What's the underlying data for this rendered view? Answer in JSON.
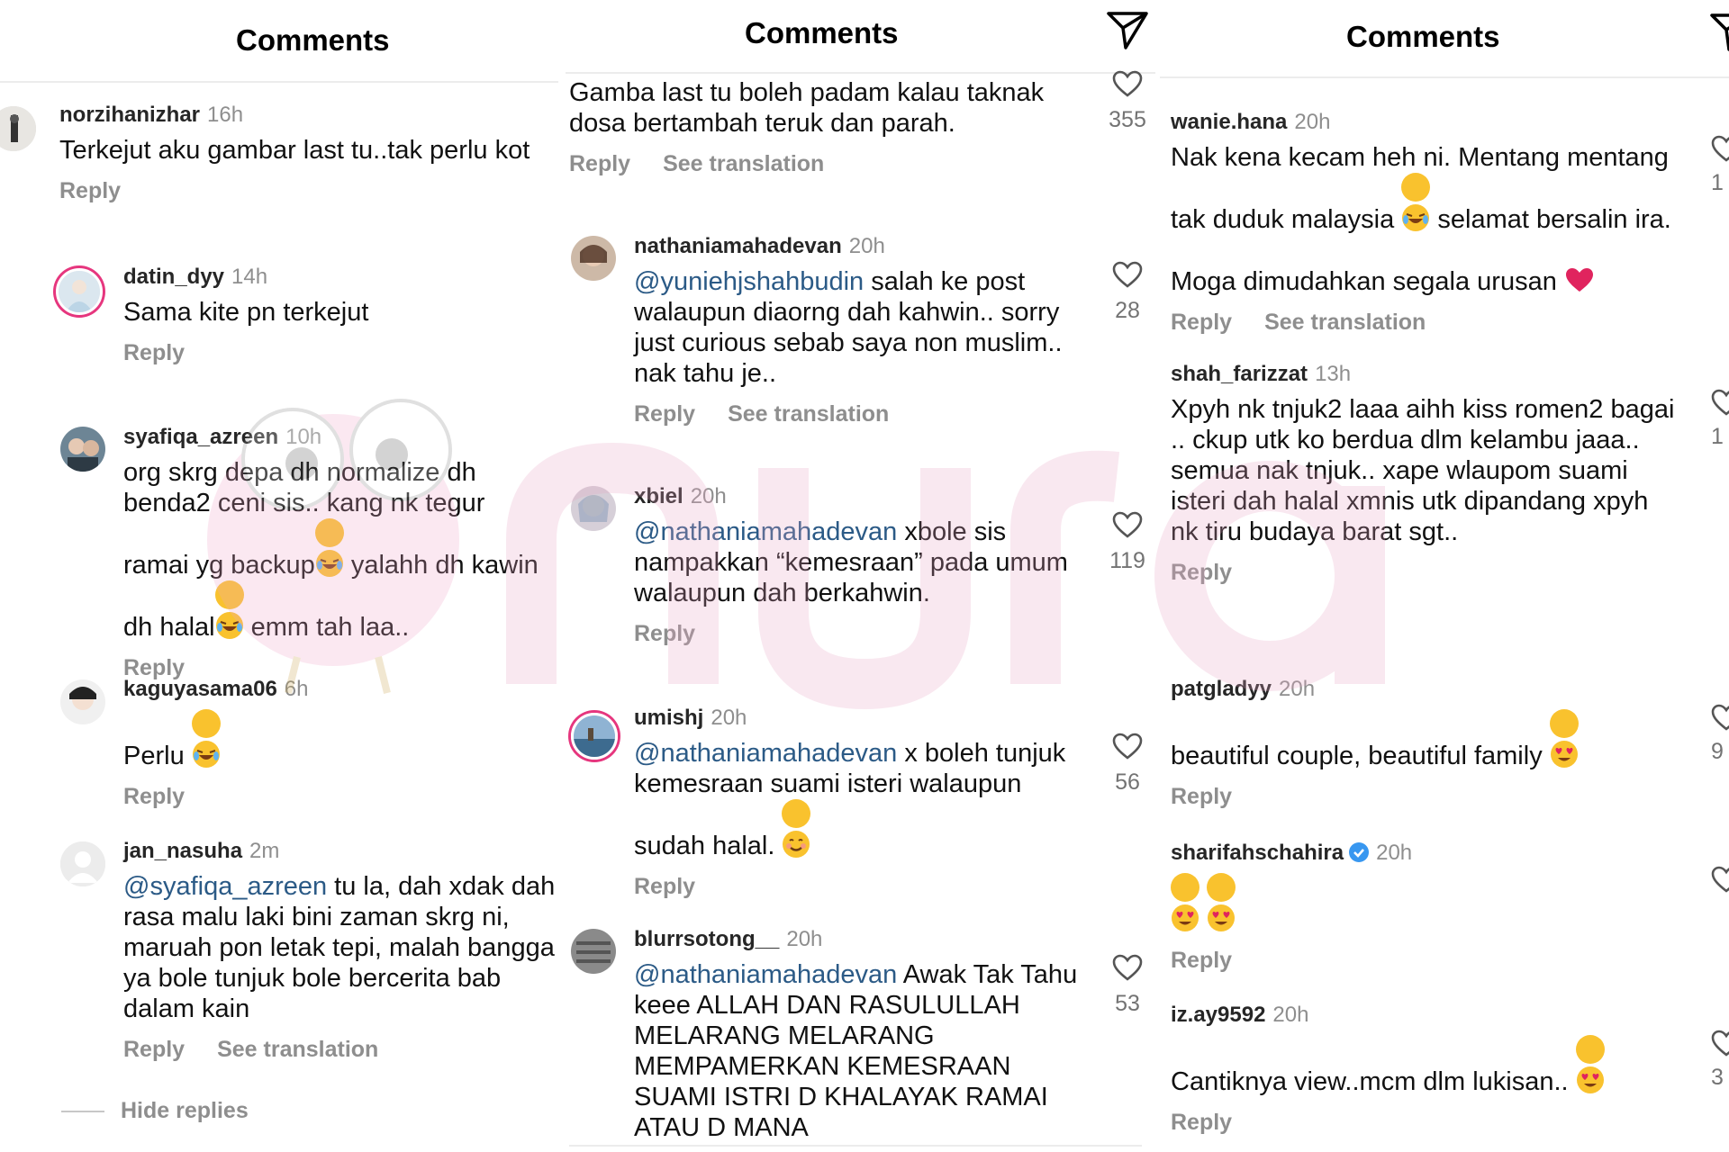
{
  "panel1": {
    "title": "Comments",
    "comments": [
      {
        "user": "norzihanizhar",
        "time": "16h",
        "text": "Terkejut aku gambar last tu..tak perlu kot",
        "reply": "Reply"
      },
      {
        "user": "datin_dyy",
        "time": "14h",
        "text": "Sama kite pn terkejut",
        "reply": "Reply"
      },
      {
        "user": "syafiqa_azreen",
        "time": "10h",
        "text1": "org skrg depa dh normalize dh benda2 ceni sis.. kang nk tegur ramai yg backup",
        "text2": " yalahh dh kawin dh halal",
        "text3": " emm tah laa..",
        "reply": "Reply"
      },
      {
        "user": "kaguyasama06",
        "time": "6h",
        "text": "Perlu ",
        "reply": "Reply"
      },
      {
        "user": "jan_nasuha",
        "time": "2m",
        "mention": "@syafiqa_azreen",
        "text": " tu la, dah xdak dah rasa malu laki bini zaman skrg ni, maruah pon letak tepi, malah bangga ya bole tunjuk bole bercerita bab dalam kain",
        "reply": "Reply",
        "translate": "See translation"
      }
    ],
    "hide_replies": "Hide replies"
  },
  "panel2": {
    "title": "Comments",
    "comments": [
      {
        "text": "Gamba last tu boleh padam kalau taknak dosa bertambah teruk dan parah.",
        "reply": "Reply",
        "translate": "See translation",
        "likes": "355"
      },
      {
        "user": "nathaniamahadevan",
        "time": "20h",
        "mention": "@yuniehjshahbudin",
        "text": " salah ke post walaupun diaorng dah kahwin.. sorry just curious sebab saya non muslim.. nak tahu je..",
        "reply": "Reply",
        "translate": "See translation",
        "likes": "28"
      },
      {
        "user": "xbiel",
        "time": "20h",
        "mention": "@nathaniamahadevan",
        "text": " xbole sis nampakkan “kemesraan” pada umum walaupun dah berkahwin.",
        "reply": "Reply",
        "likes": "119"
      },
      {
        "user": "umishj",
        "time": "20h",
        "mention": "@nathaniamahadevan",
        "text": " x boleh tunjuk kemesraan suami isteri walaupun sudah halal. ",
        "reply": "Reply",
        "likes": "56"
      },
      {
        "user": "blurrsotong__",
        "time": "20h",
        "mention": "@nathaniamahadevan",
        "text": " Awak Tak Tahu keee ALLAH DAN RASULULLAH MELARANG MELARANG MEMPAMERKAN KEMESRAAN SUAMI ISTRI D KHALAYAK RAMAI ATAU D MANA",
        "likes": "53"
      }
    ]
  },
  "panel3": {
    "title": "Comments",
    "comments": [
      {
        "user": "wanie.hana",
        "time": "20h",
        "text1": "Nak kena kecam heh ni. Mentang mentang tak duduk malaysia ",
        "text2": " selamat bersalin ira. Moga dimudahkan segala urusan ",
        "reply": "Reply",
        "translate": "See translation"
      },
      {
        "user": "shah_farizzat",
        "time": "13h",
        "text": "Xpyh nk tnjuk2 laaa aihh kiss romen2 bagai .. ckup utk ko berdua dlm kelambu jaaa.. semua nak tnjuk.. xape wlaupom suami isteri dah halal xmnis utk dipandang xpyh nk tiru budaya barat sgt..",
        "reply": "Reply"
      },
      {
        "user": "patgladyy",
        "time": "20h",
        "text": "beautiful couple, beautiful family ",
        "reply": "Reply"
      },
      {
        "user": "sharifahschahira",
        "time": "20h",
        "reply": "Reply"
      },
      {
        "user": "iz.ay9592",
        "time": "20h",
        "text": "Cantiknya view..mcm dlm lukisan.. ",
        "reply": "Reply"
      }
    ],
    "partial_counts": [
      "1",
      "1",
      "9",
      "3"
    ]
  },
  "watermark_text": "nurai",
  "colors": {
    "mention": "#2b5a86",
    "muted": "#8e8e8e",
    "heart": "#e0245e",
    "ring": "#e6367e",
    "verified": "#3897f0"
  }
}
